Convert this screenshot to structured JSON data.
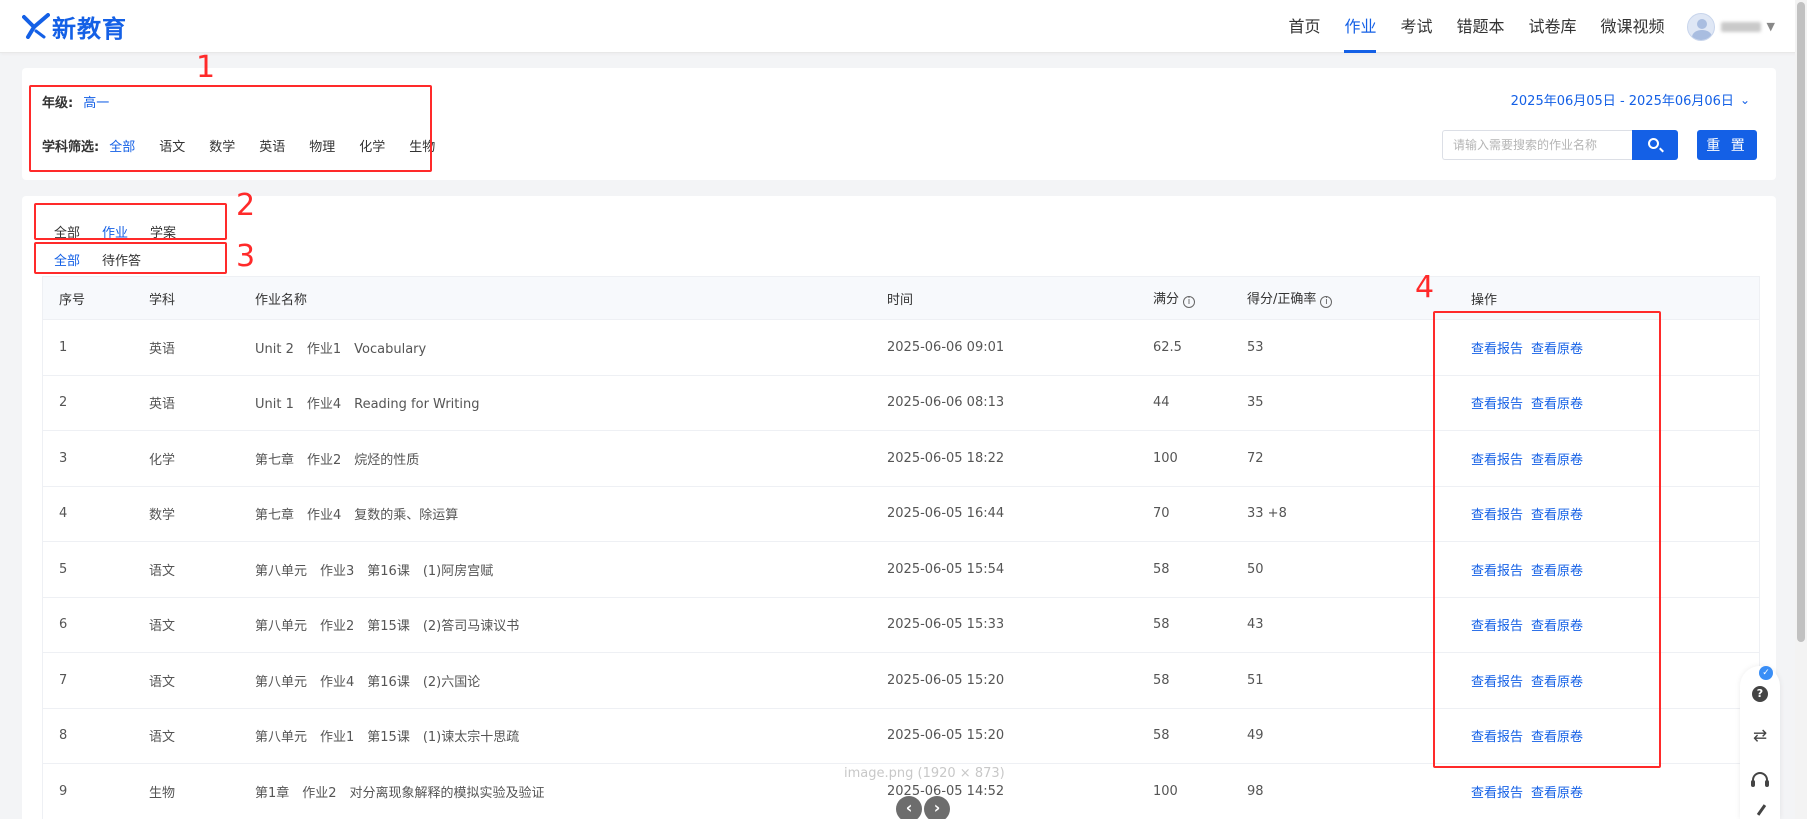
{
  "header": {
    "logo_text": "新教育",
    "nav": [
      "首页",
      "作业",
      "考试",
      "错题本",
      "试卷库",
      "微课视频"
    ],
    "nav_active_index": 1
  },
  "filters": {
    "grade_label": "年级:",
    "grade_value": "高一",
    "subject_label": "学科筛选:",
    "subjects": [
      "全部",
      "语文",
      "数学",
      "英语",
      "物理",
      "化学",
      "生物"
    ],
    "subject_active_index": 0,
    "date_range": "2025年06月05日 - 2025年06月06日",
    "search_placeholder": "请输入需要搜索的作业名称",
    "reset_label": "重 置"
  },
  "type_tabs": [
    "全部",
    "作业",
    "学案"
  ],
  "type_tab_active": 1,
  "status_tabs": [
    "全部",
    "待作答"
  ],
  "status_tab_active": 0,
  "table": {
    "columns": {
      "no": "序号",
      "subject": "学科",
      "name": "作业名称",
      "time": "时间",
      "full": "满分",
      "score": "得分/正确率",
      "ops": "操作"
    },
    "op_report": "查看报告",
    "op_original": "查看原卷",
    "rows": [
      {
        "no": "1",
        "subject": "英语",
        "name": "Unit 2　作业1　Vocabulary",
        "time": "2025-06-06 09:01",
        "full": "62.5",
        "score": "53"
      },
      {
        "no": "2",
        "subject": "英语",
        "name": "Unit 1　作业4　Reading for Writing",
        "time": "2025-06-06 08:13",
        "full": "44",
        "score": "35"
      },
      {
        "no": "3",
        "subject": "化学",
        "name": "第七章　作业2　烷烃的性质",
        "time": "2025-06-05 18:22",
        "full": "100",
        "score": "72"
      },
      {
        "no": "4",
        "subject": "数学",
        "name": "第七章　作业4　复数的乘、除运算",
        "time": "2025-06-05 16:44",
        "full": "70",
        "score": "33 +8"
      },
      {
        "no": "5",
        "subject": "语文",
        "name": "第八单元　作业3　第16课　(1)阿房宫赋",
        "time": "2025-06-05 15:54",
        "full": "58",
        "score": "50"
      },
      {
        "no": "6",
        "subject": "语文",
        "name": "第八单元　作业2　第15课　(2)答司马谏议书",
        "time": "2025-06-05 15:33",
        "full": "58",
        "score": "43"
      },
      {
        "no": "7",
        "subject": "语文",
        "name": "第八单元　作业4　第16课　(2)六国论",
        "time": "2025-06-05 15:20",
        "full": "58",
        "score": "51"
      },
      {
        "no": "8",
        "subject": "语文",
        "name": "第八单元　作业1　第15课　(1)谏太宗十思疏",
        "time": "2025-06-05 15:20",
        "full": "58",
        "score": "49"
      },
      {
        "no": "9",
        "subject": "生物",
        "name": "第1章　作业2　对分离现象解释的模拟实验及验证",
        "time": "2025-06-05 14:52",
        "full": "100",
        "score": "98"
      }
    ]
  },
  "annotations": [
    "1",
    "2",
    "3",
    "4"
  ],
  "viewer": {
    "caption": "image.png (1920 × 873)",
    "prev": "‹",
    "next": "›"
  },
  "float_bar": {
    "badge": "✓",
    "help": "?",
    "refresh": "⇄"
  }
}
